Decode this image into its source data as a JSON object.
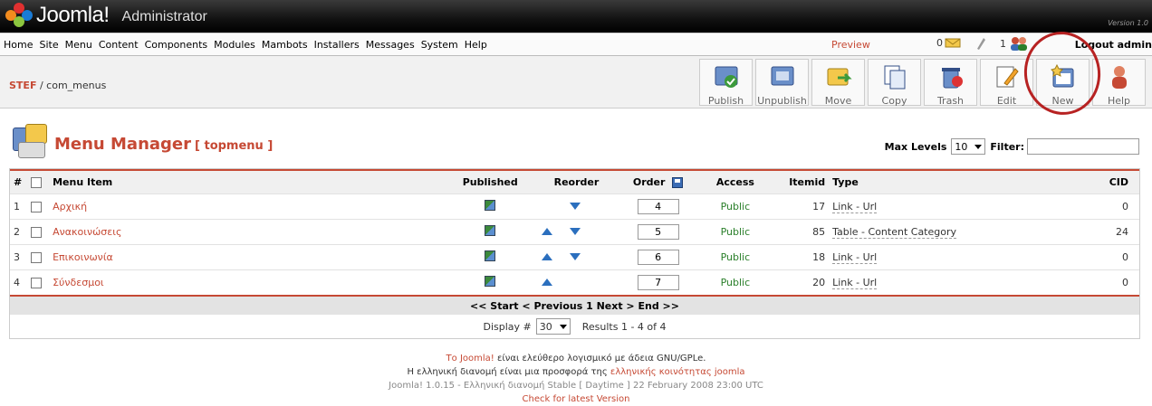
{
  "header": {
    "brand": "Joomla!",
    "sub": "Administrator",
    "version": "Version 1.0"
  },
  "menubar": {
    "items": [
      "Home",
      "Site",
      "Menu",
      "Content",
      "Components",
      "Modules",
      "Mambots",
      "Installers",
      "Messages",
      "System",
      "Help"
    ],
    "preview": "Preview",
    "count1": "0",
    "count2": "1",
    "logout": "Logout admin"
  },
  "breadcrumb": {
    "site": "STEF",
    "path": " / com_menus"
  },
  "toolbar": {
    "buttons": [
      "Publish",
      "Unpublish",
      "Move",
      "Copy",
      "Trash",
      "Edit",
      "New",
      "Help"
    ]
  },
  "page": {
    "title": "Menu Manager",
    "subtitle": "[ topmenu ]"
  },
  "filters": {
    "max_levels_label": "Max Levels",
    "max_levels_value": "10",
    "filter_label": "Filter:",
    "filter_value": ""
  },
  "table": {
    "headers": {
      "num": "#",
      "item": "Menu Item",
      "published": "Published",
      "reorder": "Reorder",
      "order": "Order",
      "access": "Access",
      "itemid": "Itemid",
      "type": "Type",
      "cid": "CID"
    },
    "rows": [
      {
        "num": "1",
        "name": "Αρχική",
        "order": "4",
        "access": "Public",
        "itemid": "17",
        "type": "Link - Url",
        "cid": "0"
      },
      {
        "num": "2",
        "name": "Ανακοινώσεις",
        "order": "5",
        "access": "Public",
        "itemid": "85",
        "type": "Table - Content Category",
        "cid": "24"
      },
      {
        "num": "3",
        "name": "Επικοινωνία",
        "order": "6",
        "access": "Public",
        "itemid": "18",
        "type": "Link - Url",
        "cid": "0"
      },
      {
        "num": "4",
        "name": "Σύνδεσμοι",
        "order": "7",
        "access": "Public",
        "itemid": "20",
        "type": "Link - Url",
        "cid": "0"
      }
    ]
  },
  "pager": {
    "text": "<< Start < Previous 1 Next > End >>",
    "display_label": "Display #",
    "display_value": "30",
    "results": "Results 1 - 4 of 4"
  },
  "footer": {
    "l1a": "Το Joomla!",
    "l1b": " είναι ελεύθερο λογισμικό με άδεια GNU/GPLe.",
    "l2a": "Η ελληνική διανομή είναι μια προσφορά της ",
    "l2b": "ελληνικής κοινότητας joomla",
    "l3": "Joomla! 1.0.15 - Ελληνική διανομή Stable [ Daytime ] 22 February 2008 23:00 UTC",
    "l4": "Check for latest Version"
  }
}
